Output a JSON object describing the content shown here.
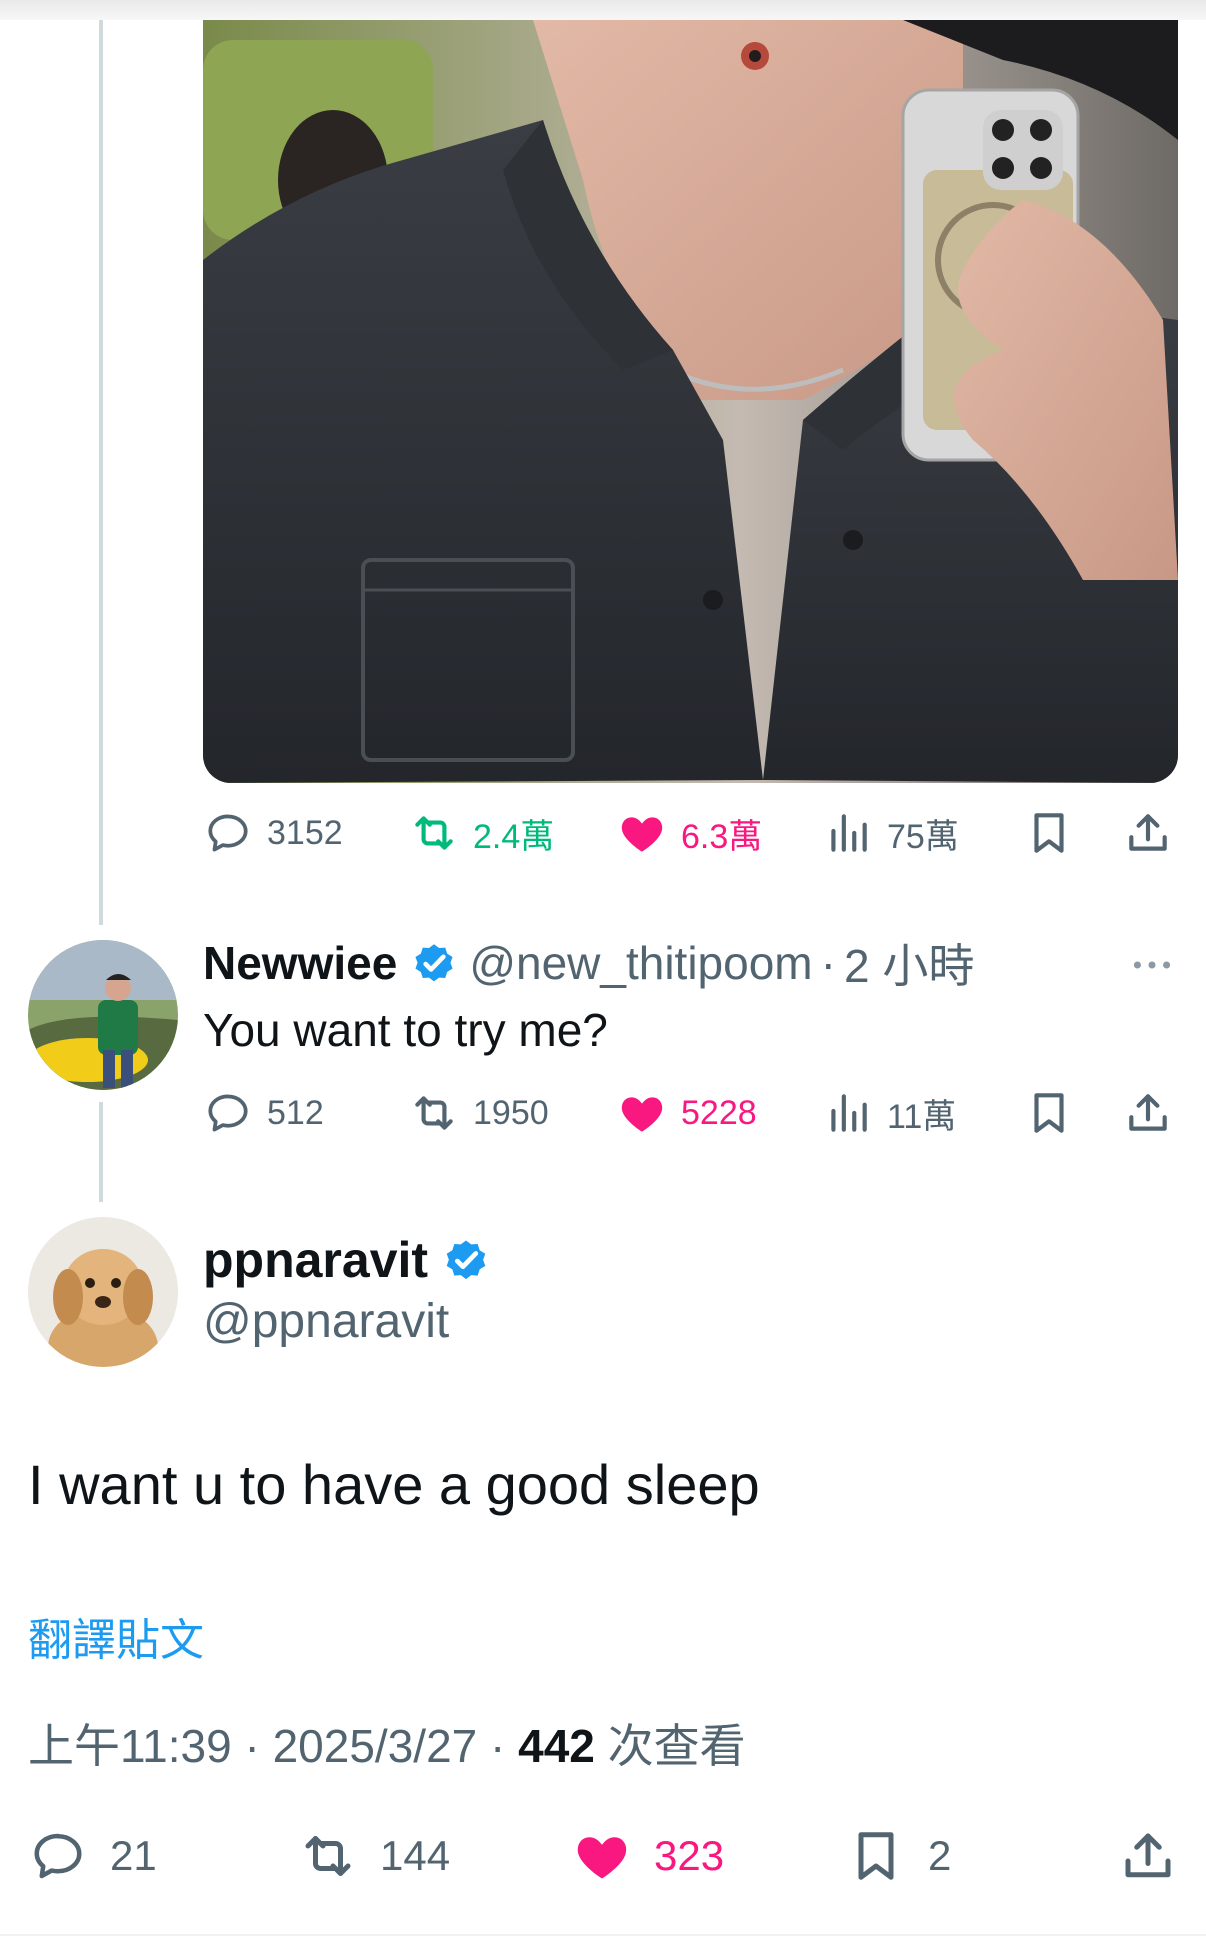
{
  "previous_post": {
    "stats": {
      "replies": "3152",
      "reposts": "2.4萬",
      "likes": "6.3萬",
      "views": "75萬"
    }
  },
  "reply": {
    "display_name": "Newwiee",
    "handle": "@new_thitipoom",
    "separator": "·",
    "time": "2 小時",
    "text": "You want to try me?",
    "stats": {
      "replies": "512",
      "reposts": "1950",
      "likes": "5228",
      "views": "11萬"
    }
  },
  "main_tweet": {
    "display_name": "ppnaravit",
    "handle": "@ppnaravit",
    "text": "I want u to have a good sleep",
    "translate_label": "翻譯貼文",
    "time": "上午11:39",
    "separator": "·",
    "date": "2025/3/27",
    "views_count": "442",
    "views_label": "次查看",
    "stats": {
      "replies": "21",
      "reposts": "144",
      "likes": "323",
      "bookmarks": "2"
    }
  },
  "colors": {
    "accent_blue": "#1d9bf0",
    "like_pink": "#f91880",
    "repost_green": "#00ba7c",
    "muted_gray": "#536471",
    "thread_line": "#cfd9de"
  },
  "icons": [
    "reply-icon",
    "repost-icon",
    "like-icon",
    "views-icon",
    "bookmark-icon",
    "share-icon",
    "verified-icon",
    "more-icon"
  ]
}
